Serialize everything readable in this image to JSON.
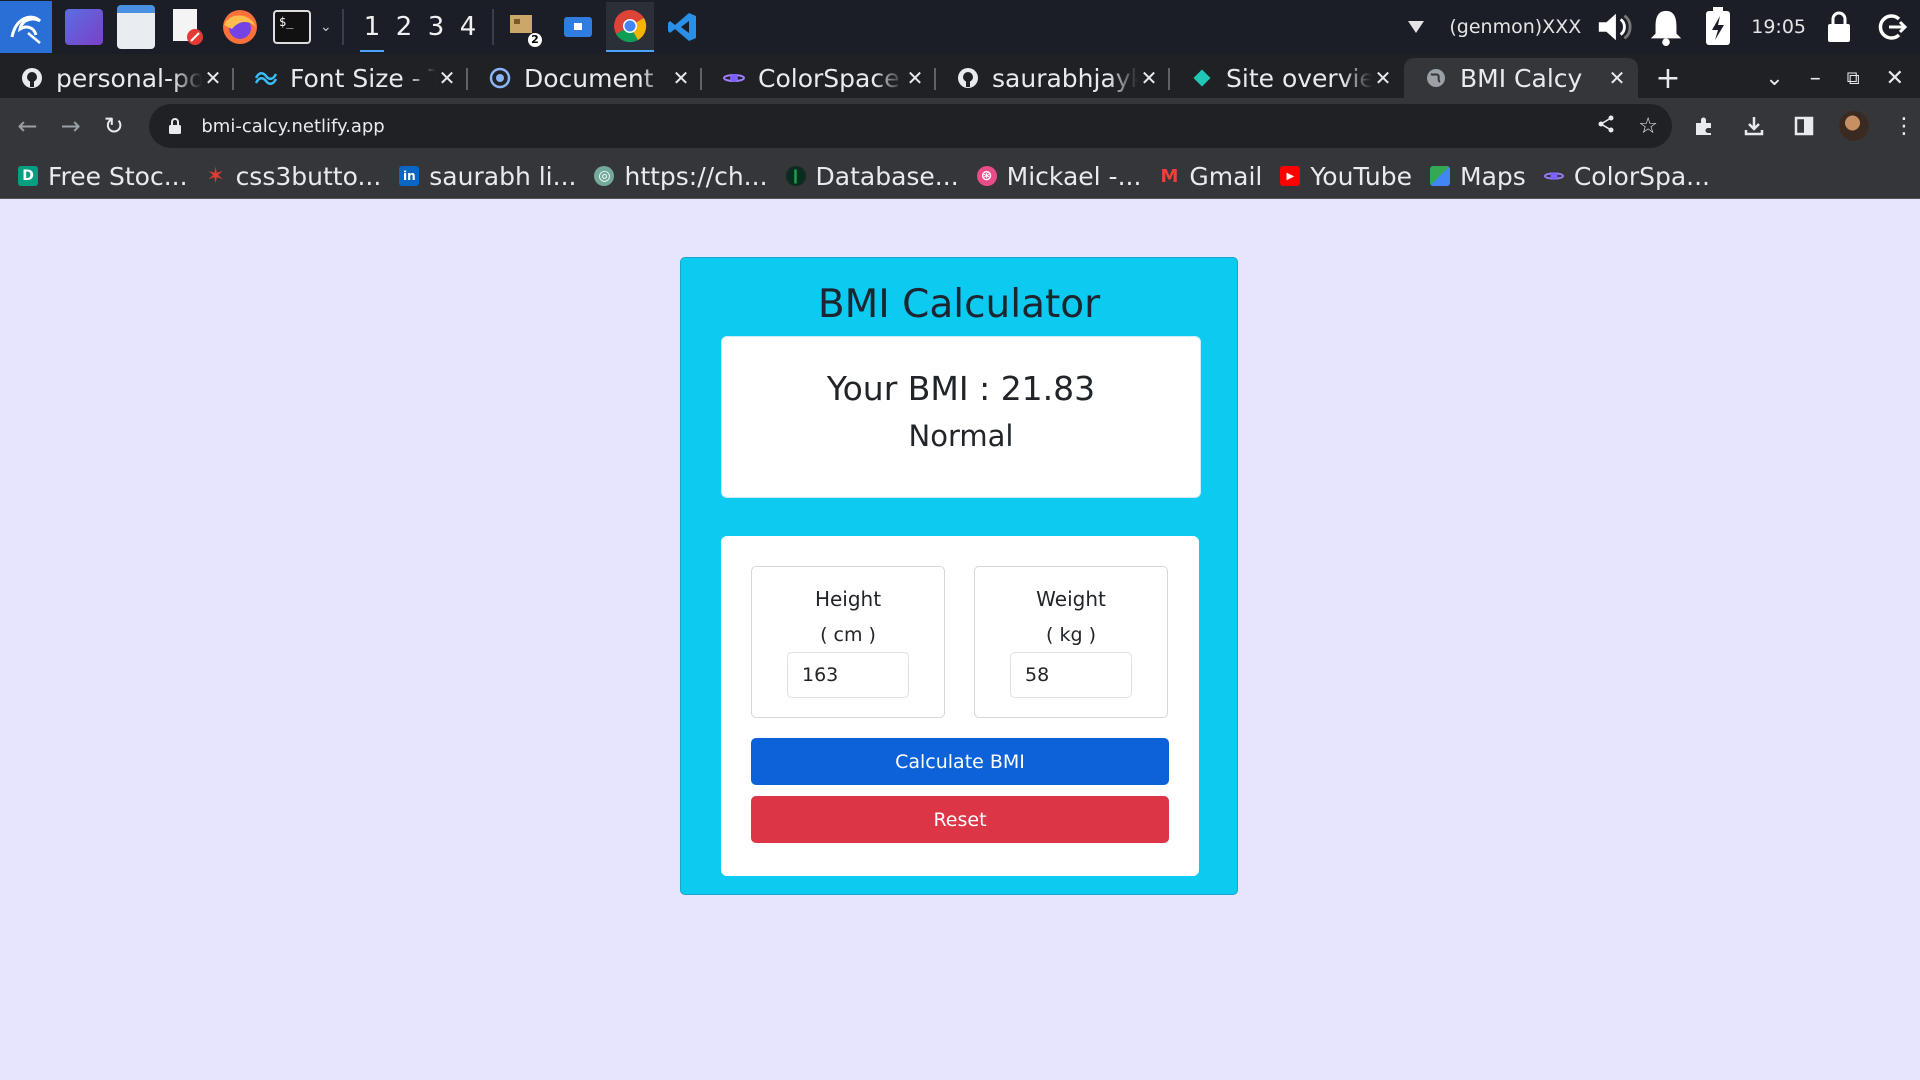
{
  "taskbar": {
    "workspaces": [
      "1",
      "2",
      "3",
      "4"
    ],
    "active_workspace": "1",
    "badge_count": "2",
    "genmon": "(genmon)XXX",
    "clock": "19:05"
  },
  "tabs": [
    {
      "title": "personal-por",
      "icon": "github-icon"
    },
    {
      "title": "Font Size - Ta",
      "icon": "tailwind-icon"
    },
    {
      "title": "Document",
      "icon": "globe-icon"
    },
    {
      "title": "ColorSpace -",
      "icon": "colorspace-icon"
    },
    {
      "title": "saurabhjayka",
      "icon": "github-icon"
    },
    {
      "title": "Site overview",
      "icon": "netlify-icon"
    },
    {
      "title": "BMI Calcy",
      "icon": "globe-icon",
      "active": true
    }
  ],
  "omnibox": {
    "url": "bmi-calcy.netlify.app"
  },
  "bookmarks": [
    {
      "label": "Free Stoc...",
      "icon": "pexels-icon",
      "color": "#05a081"
    },
    {
      "label": "css3butto...",
      "icon": "star-icon",
      "color": "#e53935"
    },
    {
      "label": "saurabh li...",
      "icon": "linkedin-icon",
      "color": "#0a66c2"
    },
    {
      "label": "https://ch...",
      "icon": "chatgpt-icon",
      "color": "#74aa9c"
    },
    {
      "label": "Database...",
      "icon": "mongodb-icon",
      "color": "#13aa52"
    },
    {
      "label": "Mickael -...",
      "icon": "dribbble-icon",
      "color": "#ea4c89"
    },
    {
      "label": "Gmail",
      "icon": "gmail-icon",
      "color": "#ea4335"
    },
    {
      "label": "YouTube",
      "icon": "youtube-icon",
      "color": "#ff0000"
    },
    {
      "label": "Maps",
      "icon": "maps-icon",
      "color": "#34a853"
    },
    {
      "label": "ColorSpa...",
      "icon": "colorspace-icon",
      "color": "#7b61ff"
    }
  ],
  "app": {
    "title": "BMI Calculator",
    "result": {
      "label": "Your BMI : 21.83",
      "category": "Normal"
    },
    "height": {
      "label": "Height",
      "unit": "( cm )",
      "value": "163"
    },
    "weight": {
      "label": "Weight",
      "unit": "( kg )",
      "value": "58"
    },
    "calculate_label": "Calculate BMI",
    "reset_label": "Reset"
  },
  "colors": {
    "page_bg": "#e7e5fd",
    "card_bg": "#0dcaf0",
    "calculate_btn": "#0d62d9",
    "reset_btn": "#dc3545"
  }
}
